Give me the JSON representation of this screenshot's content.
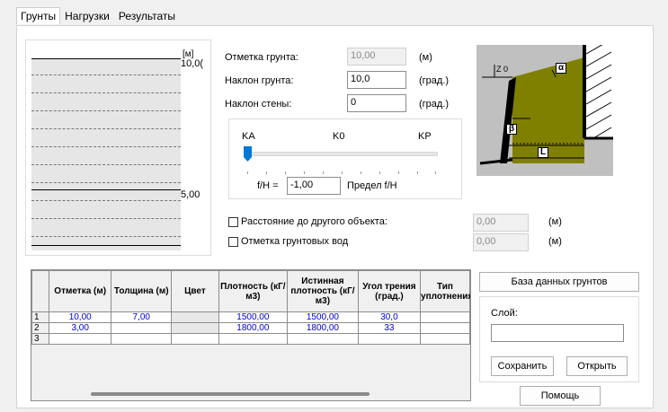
{
  "tabs": [
    {
      "label": "Грунты"
    },
    {
      "label": "Нагрузки"
    },
    {
      "label": "Результаты"
    }
  ],
  "profile": {
    "unit": "[м]",
    "top_value": "10,0(",
    "mid_value": "5,00"
  },
  "params": {
    "ground_mark_label": "Отметка грунта:",
    "ground_mark_value": "10,00",
    "ground_mark_unit": "(м)",
    "ground_slope_label": "Наклон грунта:",
    "ground_slope_value": "10,0",
    "ground_slope_unit": "(град.)",
    "wall_slope_label": "Наклон стены:",
    "wall_slope_value": "0",
    "wall_slope_unit": "(град.)"
  },
  "pressure": {
    "ka": "KA",
    "k0": "K0",
    "kp": "KP",
    "slider_fraction": 0.0,
    "fh_label": "f/H =",
    "fh_value": "-1,00",
    "fh_limit": "Предел f/H"
  },
  "diagram": {
    "z_label": "Z 0",
    "alpha": "α",
    "beta": "β",
    "l_label": "L",
    "soil_color": "#808000",
    "sky_color": "#c0c0c0"
  },
  "options": {
    "distance_label": "Расстояние до другого объекта:",
    "distance_value": "0,00",
    "distance_unit": "(м)",
    "groundwater_label": "Отметка грунтовых вод",
    "groundwater_value": "0,00",
    "groundwater_unit": "(м)"
  },
  "table": {
    "headers": [
      "Отметка (м)",
      "Толщина (м)",
      "Цвет",
      "Плотность (кГ/м3)",
      "Истинная плотность (кГ/м3)",
      "Угол трения (град.)",
      "Тип уплотнения"
    ],
    "rows": [
      {
        "n": "1",
        "mark": "10,00",
        "thick": "7,00",
        "density": "1500,00",
        "true_density": "1500,00",
        "angle": "30,0"
      },
      {
        "n": "2",
        "mark": "3,00",
        "thick": "",
        "density": "1800,00",
        "true_density": "1800,00",
        "angle": "33"
      },
      {
        "n": "3",
        "mark": "",
        "thick": "",
        "density": "",
        "true_density": "",
        "angle": ""
      }
    ]
  },
  "side": {
    "db_button": "База данных грунтов",
    "layer_label": "Слой:",
    "layer_value": "",
    "save_button": "Сохранить",
    "open_button": "Открыть",
    "help_button": "Помощь"
  }
}
